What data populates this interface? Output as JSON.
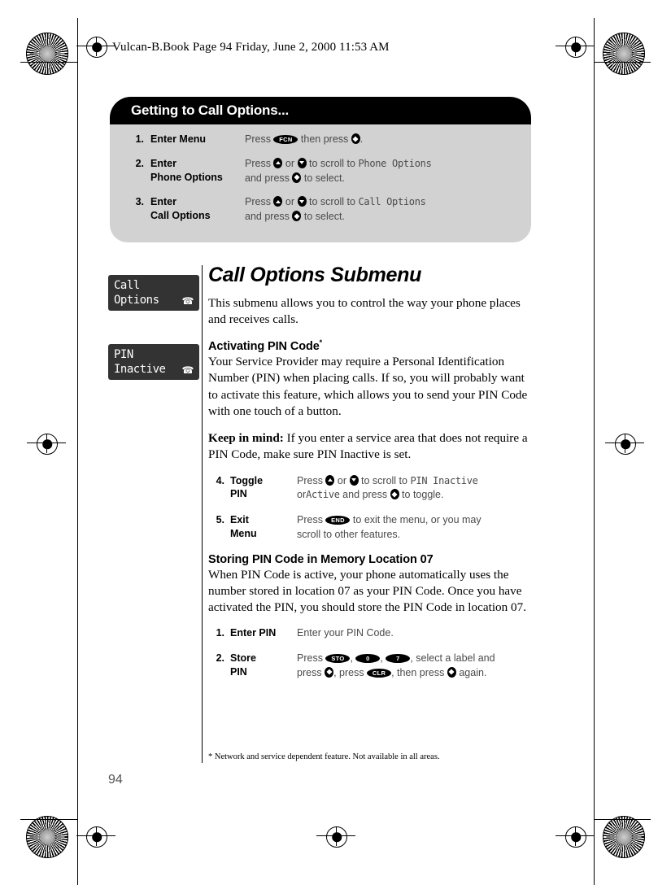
{
  "header": {
    "running_head": "Vulcan-B.Book  Page 94  Friday, June 2, 2000  11:53 AM"
  },
  "callout": {
    "title": "Getting to Call Options...",
    "steps": [
      {
        "num": "1.",
        "label_line1": "Enter Menu",
        "label_line2": "",
        "desc_line1_a": "Press",
        "desc_key1": "FCN",
        "desc_line1_b": "then press",
        "desc_line1_c": ".",
        "desc_line2": ""
      },
      {
        "num": "2.",
        "label_line1": "Enter",
        "label_line2": "Phone Options",
        "desc_line1_a": "Press",
        "desc_line1_b": "or",
        "desc_line1_c": "to scroll to",
        "desc_lcd": "Phone Options",
        "desc_line2_a": "and press",
        "desc_line2_b": "to select."
      },
      {
        "num": "3.",
        "label_line1": "Enter",
        "label_line2": "Call Options",
        "desc_line1_a": "Press",
        "desc_line1_b": "or",
        "desc_line1_c": "to scroll to",
        "desc_lcd": "Call Options",
        "desc_line2_a": "and press",
        "desc_line2_b": "to select."
      }
    ]
  },
  "lcd_screens": [
    {
      "line1": "Call",
      "line2": "Options",
      "icon": "phone-icon"
    },
    {
      "line1": "PIN",
      "line2": "Inactive",
      "icon": "phone-icon"
    }
  ],
  "main": {
    "title": "Call Options Submenu",
    "intro": "This submenu allows you to control the way your phone places and receives calls.",
    "subhead_activating": "Activating PIN Code",
    "subhead_activating_mark": "*",
    "paragraph_activating": "Your Service Provider may require a Personal Identification Number (PIN) when placing calls. If so, you will probably want to activate this feature, which allows you to send your PIN Code with one touch of a button.",
    "keep_in_mind_label": "Keep in mind:",
    "keep_in_mind_text": "If you enter a service area that does not require a PIN Code, make sure PIN Inactive is set.",
    "subhead_storing": "Storing PIN Code in Memory Location 07",
    "paragraph_storing": "When PIN Code is active, your phone automatically uses the number stored in location 07 as your PIN Code. Once you have activated the PIN, you should store the PIN Code in location 07."
  },
  "toggle_steps": [
    {
      "num": "4.",
      "label_line1": "Toggle",
      "label_line2": "PIN",
      "line1_a": "Press",
      "line1_b": "or",
      "line1_c": "to scroll to",
      "line1_lcd": "PIN Inactive",
      "line2_a": "or",
      "line2_lcd": "Active",
      "line2_b": "and press",
      "line2_c": "to toggle."
    },
    {
      "num": "5.",
      "label_line1": "Exit",
      "label_line2": "Menu",
      "line1_a": "Press",
      "line1_key": "END",
      "line1_b": "to exit the menu, or you may",
      "line2_a": "scroll to other features."
    }
  ],
  "store_steps": [
    {
      "num": "1.",
      "label_line1": "Enter PIN",
      "label_line2": "",
      "line1_a": "Enter your PIN Code.",
      "line2_a": ""
    },
    {
      "num": "2.",
      "label_line1": "Store",
      "label_line2": "PIN",
      "line1_a": "Press",
      "key_sto": "STO",
      "key_zero": "0",
      "key_seven": "7",
      "line1_b": ", select a label and",
      "line2_a": "press",
      "line2_b": ", press",
      "key_clr": "CLR",
      "line2_c": ", then press",
      "line2_d": "again."
    }
  ],
  "footnote": "* Network and service dependent feature. Not available in all areas.",
  "page_number": "94",
  "colors": {
    "callout_header": "#000000",
    "callout_body": "#d2d2d2",
    "lcd_background": "#333333",
    "step_text": "#4a4a4a",
    "page_number": "#555555"
  }
}
